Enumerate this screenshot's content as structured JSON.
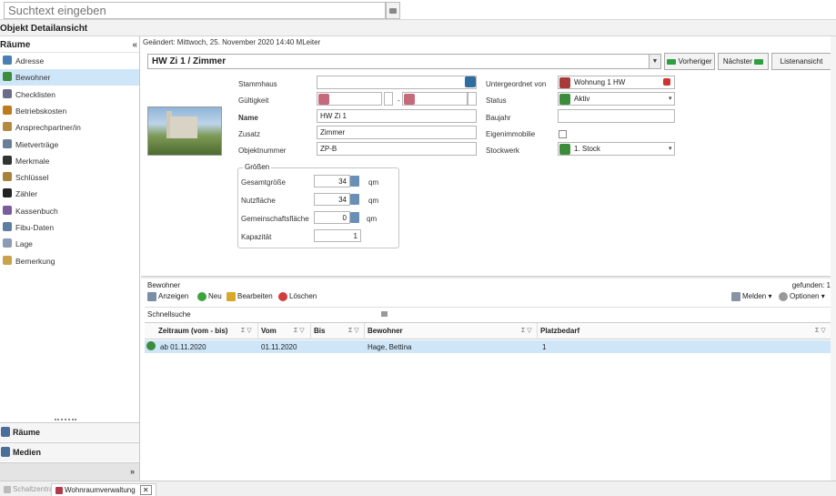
{
  "search": {
    "placeholder": "Suchtext eingeben"
  },
  "window": {
    "title": "Objekt Detailansicht"
  },
  "leftpane": {
    "header": "Räume",
    "collapse": "«",
    "items": [
      {
        "label": "Adresse",
        "icon": "address-icon",
        "color": "#4a7fb5"
      },
      {
        "label": "Bewohner",
        "icon": "residents-icon",
        "color": "#3b8c3b"
      },
      {
        "label": "Checklisten",
        "icon": "checklist-icon",
        "color": "#6b6b8a"
      },
      {
        "label": "Betriebskosten",
        "icon": "costs-icon",
        "color": "#c07a1e"
      },
      {
        "label": "Ansprechpartner/in",
        "icon": "contact-icon",
        "color": "#b5893e"
      },
      {
        "label": "Mietverträge",
        "icon": "contract-icon",
        "color": "#6a7d99"
      },
      {
        "label": "Merkmale",
        "icon": "features-icon",
        "color": "#333333"
      },
      {
        "label": "Schlüssel",
        "icon": "key-icon",
        "color": "#a8823a"
      },
      {
        "label": "Zähler",
        "icon": "meter-icon",
        "color": "#222222"
      },
      {
        "label": "Kassenbuch",
        "icon": "cashbook-icon",
        "color": "#7a5c9a"
      },
      {
        "label": "Fibu-Daten",
        "icon": "fibu-icon",
        "color": "#5a7fa0"
      },
      {
        "label": "Lage",
        "icon": "location-icon",
        "color": "#8a9cb3"
      },
      {
        "label": "Bemerkung",
        "icon": "note-icon",
        "color": "#c9a24a"
      }
    ],
    "panes": [
      {
        "label": "Räume",
        "icon": "rooms-icon",
        "color": "#4a6d9a"
      },
      {
        "label": "Medien",
        "icon": "media-icon",
        "color": "#4a6d9a"
      }
    ],
    "more": "»"
  },
  "main": {
    "changed": "Geändert: Mittwoch, 25. November 2020 14:40  MLeiter",
    "object": "HW Zi 1 / Zimmer",
    "buttons": {
      "prev": "Vorheriger",
      "next": "Nächster",
      "list": "Listenansicht"
    },
    "form": {
      "stammhaus_label": "Stammhaus",
      "stammhaus_value": "",
      "gueltigkeit_label": "Gültigkeit",
      "gueltig_sep": "-",
      "name_label": "Name",
      "name_value": "HW Zi 1",
      "zusatz_label": "Zusatz",
      "zusatz_value": "Zimmer",
      "objnr_label": "Objektnummer",
      "objnr_value": "ZP-B",
      "untergeordnet_label": "Untergeordnet von",
      "untergeordnet_value": "Wohnung 1 HW",
      "status_label": "Status",
      "status_value": "Aktiv",
      "baujahr_label": "Baujahr",
      "baujahr_value": "",
      "eigen_label": "Eigenimmobilie",
      "stockwerk_label": "Stockwerk",
      "stockwerk_value": "1. Stock"
    },
    "groessen": {
      "title": "Größen",
      "gesamt_label": "Gesamtgröße",
      "gesamt_value": "34",
      "nutz_label": "Nutzfläche",
      "nutz_value": "34",
      "gemein_label": "Gemeinschaftsfläche",
      "gemein_value": "0",
      "kapa_label": "Kapazität",
      "kapa_value": "1",
      "unit": "qm"
    }
  },
  "bewohner": {
    "title": "Bewohner",
    "found": "gefunden: 1",
    "toolbar": {
      "show": "Anzeigen",
      "new": "Neu",
      "edit": "Bearbeiten",
      "delete": "Löschen",
      "report": "Melden",
      "options": "Optionen"
    },
    "quicksearch": "Schnellsuche",
    "columns": [
      "Zeitraum (vom - bis)",
      "Vom",
      "Bis",
      "Bewohner",
      "Platzbedarf"
    ],
    "rows": [
      {
        "zeitraum": "ab 01.11.2020",
        "vom": "01.11.2020",
        "bis": "",
        "bewohner": "Hage, Bettina",
        "platz": "1"
      }
    ]
  },
  "statusbar": {
    "tabs": [
      "Schaltzentrale",
      "Wohnraumverwaltung"
    ]
  }
}
